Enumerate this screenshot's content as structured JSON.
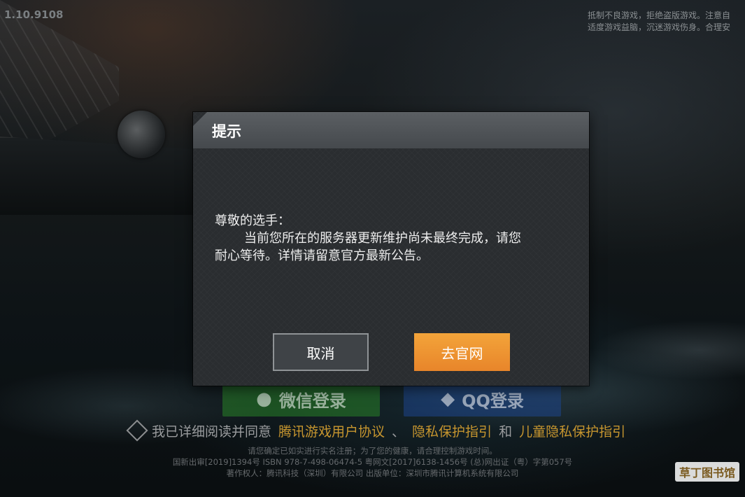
{
  "version": "1.10.9108",
  "top_notice": {
    "line1": "抵制不良游戏，拒绝盗版游戏。注意自",
    "line2": "适度游戏益脑，沉迷游戏伤身。合理安"
  },
  "login": {
    "wechat_label": "微信登录",
    "qq_label": "QQ登录"
  },
  "agreement": {
    "prefix": "我已详细阅读并同意",
    "link1": "腾讯游戏用户协议",
    "sep1": "、",
    "link2": "隐私保护指引",
    "sep2": "和",
    "link3": "儿童隐私保护指引"
  },
  "footer": {
    "line1": "请您确定已如实进行实名注册；为了您的健康，请合理控制游戏时间。",
    "line2": "国新出审[2019]1394号  ISBN 978-7-498-06474-5  粤网文[2017]6138-1456号  (总)网出证（粤）字第057号",
    "line3": "著作权人：腾讯科技（深圳）有限公司   出版单位：深圳市腾讯计算机系统有限公司"
  },
  "dialog": {
    "title": "提示",
    "greeting": "尊敬的选手：",
    "line1": "当前您所在的服务器更新维护尚未最终完成，请您",
    "line2": "耐心等待。详情请留意官方最新公告。",
    "cancel_label": "取消",
    "confirm_label": "去官网"
  },
  "watermark": "草丁图书馆",
  "colors": {
    "accent_orange": "#ee922f",
    "link_gold": "#c7962f",
    "wechat_green": "#28822a",
    "qq_blue": "#1e468c"
  }
}
